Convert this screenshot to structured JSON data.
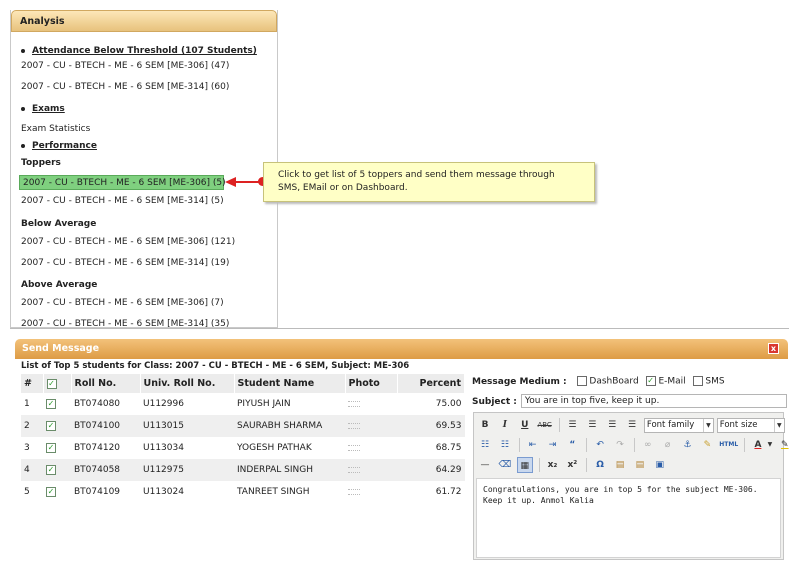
{
  "analysis": {
    "title": "Analysis",
    "attendance": {
      "heading": "Attendance Below Threshold (107 Students)",
      "items": [
        "2007 - CU - BTECH - ME - 6 SEM [ME-306] (47)",
        "2007 - CU - BTECH - ME - 6 SEM [ME-314] (60)"
      ]
    },
    "exams": {
      "heading": "Exams",
      "items": [
        "Exam Statistics"
      ]
    },
    "performance": {
      "heading": "Performance",
      "toppers_label": "Toppers",
      "toppers": [
        "2007 - CU - BTECH - ME - 6 SEM [ME-306] (5)",
        "2007 - CU - BTECH - ME - 6 SEM [ME-314] (5)"
      ],
      "below_label": "Below Average",
      "below": [
        "2007 - CU - BTECH - ME - 6 SEM [ME-306] (121)",
        "2007 - CU - BTECH - ME - 6 SEM [ME-314] (19)"
      ],
      "above_label": "Above Average",
      "above": [
        "2007 - CU - BTECH - ME - 6 SEM [ME-306] (7)",
        "2007 - CU - BTECH - ME - 6 SEM [ME-314] (35)"
      ]
    }
  },
  "tooltip": {
    "line1": "Click to get list of 5 toppers and send them message through",
    "line2": "SMS, EMail or on Dashboard."
  },
  "dialog": {
    "title": "Send Message",
    "close_glyph": "x",
    "caption": "List of Top 5 students for Class: 2007 - CU - BTECH - ME - 6 SEM, Subject: ME-306",
    "columns": [
      "#",
      "",
      "Roll No.",
      "Univ. Roll No.",
      "Student Name",
      "Photo",
      "Percent"
    ],
    "students": [
      {
        "n": "1",
        "roll": "BT074080",
        "univ": "U112996",
        "name": "PIYUSH JAIN",
        "percent": "75.00"
      },
      {
        "n": "2",
        "roll": "BT074100",
        "univ": "U113015",
        "name": "SAURABH SHARMA",
        "percent": "69.53"
      },
      {
        "n": "3",
        "roll": "BT074120",
        "univ": "U113034",
        "name": "YOGESH PATHAK",
        "percent": "68.75"
      },
      {
        "n": "4",
        "roll": "BT074058",
        "univ": "U112975",
        "name": "INDERPAL SINGH",
        "percent": "64.29"
      },
      {
        "n": "5",
        "roll": "BT074109",
        "univ": "U113024",
        "name": "TANREET SINGH",
        "percent": "61.72"
      }
    ],
    "medium": {
      "label": "Message Medium :",
      "options": [
        {
          "label": "DashBoard",
          "checked": false
        },
        {
          "label": "E-Mail",
          "checked": true
        },
        {
          "label": "SMS",
          "checked": false
        }
      ]
    },
    "subject": {
      "label": "Subject :",
      "value": "You are in top five, keep it up."
    },
    "editor": {
      "font_family": "Font family",
      "font_size": "Font size",
      "html_label": "HTML",
      "body": "Congratulations, you are in top 5 for the subject ME-306. Keep it up. Anmol Kalia"
    }
  },
  "colors": {
    "highlight": "#7fd07f",
    "tooltip_bg": "#ffffc6",
    "arrow": "#dd2222",
    "dialog_header": "#dd9b45"
  }
}
